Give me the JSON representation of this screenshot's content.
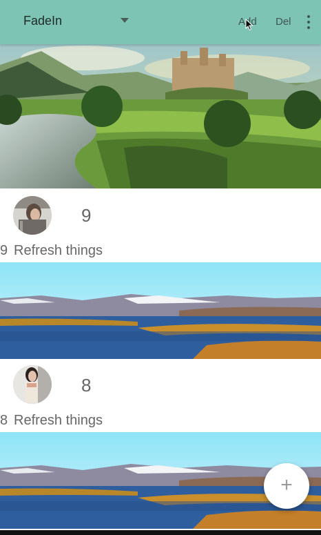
{
  "toolbar": {
    "spinner_value": "FadeIn",
    "add_label": "Add",
    "del_label": "Del",
    "background": "#7ec4b5",
    "overflow_icon": "more-vert-icon"
  },
  "items": [
    {
      "number": "9",
      "index": "9",
      "text": "Refresh things"
    },
    {
      "number": "8",
      "index": "8",
      "text": "Refresh things"
    }
  ],
  "fab": {
    "label": "+",
    "icon": "add-icon"
  }
}
